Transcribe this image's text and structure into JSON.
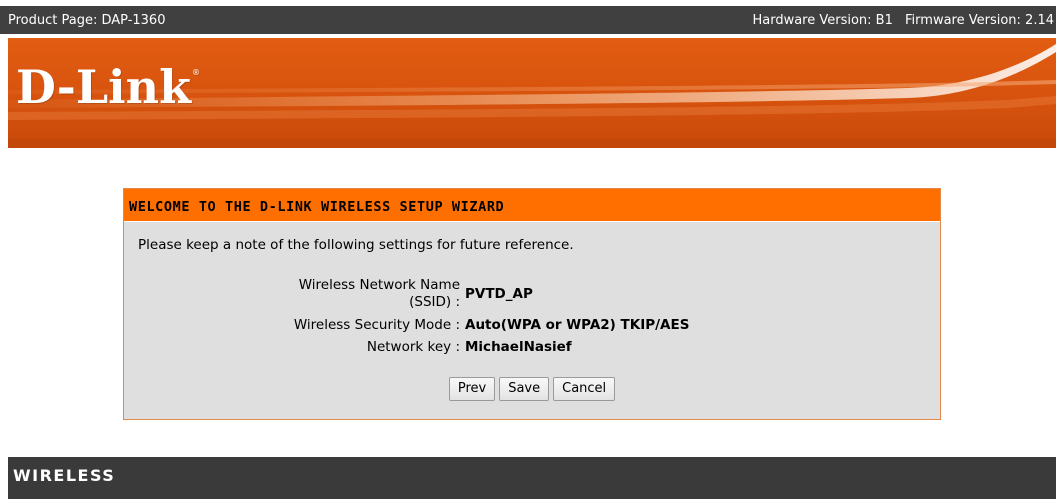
{
  "topbar": {
    "product_page": "Product Page: DAP-1360",
    "hardware_version": "Hardware Version: B1",
    "firmware_version": "Firmware Version: 2.14"
  },
  "banner": {
    "logo_text": "D-Link",
    "logo_mark": "®",
    "colors": {
      "orange": "#d9540e",
      "highlight": "#f59a5a"
    }
  },
  "wizard": {
    "title": "WELCOME TO THE D-LINK WIRELESS SETUP WIZARD",
    "note": "Please keep a note of the following settings for future reference.",
    "fields": [
      {
        "label": "Wireless Network Name (SSID) :",
        "value": "PVTD_AP"
      },
      {
        "label": "Wireless Security Mode :",
        "value": "Auto(WPA or WPA2) TKIP/AES"
      },
      {
        "label": "Network key :",
        "value": "MichaelNasief"
      }
    ],
    "buttons": {
      "prev": "Prev",
      "save": "Save",
      "cancel": "Cancel"
    },
    "colors": {
      "header": "#ff6f00",
      "body": "#dfdfdf",
      "border": "#e38a4a"
    }
  },
  "section": {
    "title": "WIRELESS"
  }
}
